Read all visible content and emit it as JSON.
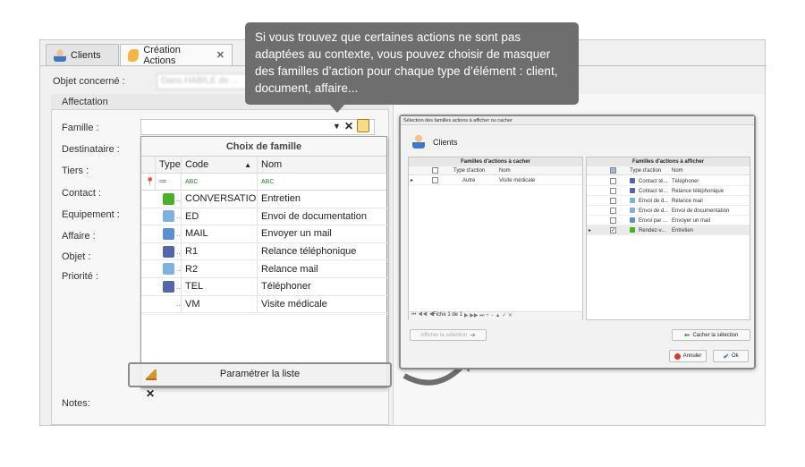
{
  "tabs": [
    {
      "label": "Clients"
    },
    {
      "label": "Création Actions"
    }
  ],
  "form": {
    "objet_label": "Objet concerné :",
    "objet_value": "Dans HABILE de ...",
    "affectation_label": "Affectation",
    "famille_label": "Famille :",
    "destinataire_label": "Destinataire :",
    "tiers_label": "Tiers :",
    "contact_label": "Contact :",
    "equipement_label": "Equipement :",
    "affaire_label": "Affaire :",
    "objet2_label": "Objet :",
    "priorite_label": "Priorité :",
    "notes_label": "Notes:"
  },
  "dropdown": {
    "title": "Choix de famille",
    "columns": [
      "Type",
      "Code",
      "Nom"
    ],
    "filter_code": "ABC",
    "filter_nom": "ABC",
    "rows": [
      {
        "code": "CONVERSATION",
        "nom": "Entretien",
        "icon": "green-person-icon",
        "color": "#4caf2a"
      },
      {
        "code": "ED",
        "nom": "Envoi de documentation",
        "icon": "document-icon",
        "color": "#7fb0e0"
      },
      {
        "code": "MAIL",
        "nom": "Envoyer un mail",
        "icon": "mail-icon",
        "color": "#5b8fd0"
      },
      {
        "code": "R1",
        "nom": "Relance téléphonique",
        "icon": "phone-icon",
        "color": "#5566a8"
      },
      {
        "code": "R2",
        "nom": "Relance mail",
        "icon": "document-icon",
        "color": "#7fb0e0"
      },
      {
        "code": "TEL",
        "nom": "Téléphoner",
        "icon": "phone-icon",
        "color": "#5566a8"
      },
      {
        "code": "VM",
        "nom": "Visite médicale",
        "icon": "",
        "color": ""
      }
    ],
    "param_label": "Paramétrer la liste"
  },
  "tooltip": {
    "text": "Si vous trouvez que certaines actions ne sont pas adaptées au contexte, vous pouvez choisir de masquer des familles d’action pour chaque type d’élément : client, document, affaire..."
  },
  "dialog": {
    "title": "Sélection des familles actions à afficher ou cacher",
    "subtitle": "Clients",
    "left_header": "Familles d'actions à cacher",
    "right_header": "Familles d'actions à afficher",
    "col_type": "Type d'action",
    "col_nom": "Nom",
    "left_rows": [
      {
        "type": "Autre",
        "nom": "Visite médicale"
      }
    ],
    "right_rows": [
      {
        "type": "Contact té...",
        "nom": "Téléphoner",
        "checked": false
      },
      {
        "type": "Contact té...",
        "nom": "Relance téléphonique",
        "checked": false
      },
      {
        "type": "Envoi de d...",
        "nom": "Relance mail",
        "checked": false
      },
      {
        "type": "Envoi de d...",
        "nom": "Envoi de documentation",
        "checked": false
      },
      {
        "type": "Envoi par ...",
        "nom": "Envoyer un mail",
        "checked": false
      },
      {
        "type": "Rendez-v...",
        "nom": "Entretien",
        "checked": true
      }
    ],
    "pager": "Fiche 1 de 1",
    "btn_show": "Afficher la sélection",
    "btn_hide": "Cacher la sélection",
    "btn_cancel": "Annuler",
    "btn_ok": "Ok"
  },
  "colors": {
    "tooltip_bg": "#6e6e6e",
    "cancel": "#d33b2c",
    "ok": "#2f7bd6",
    "green_arrow": "#3aa13a"
  }
}
